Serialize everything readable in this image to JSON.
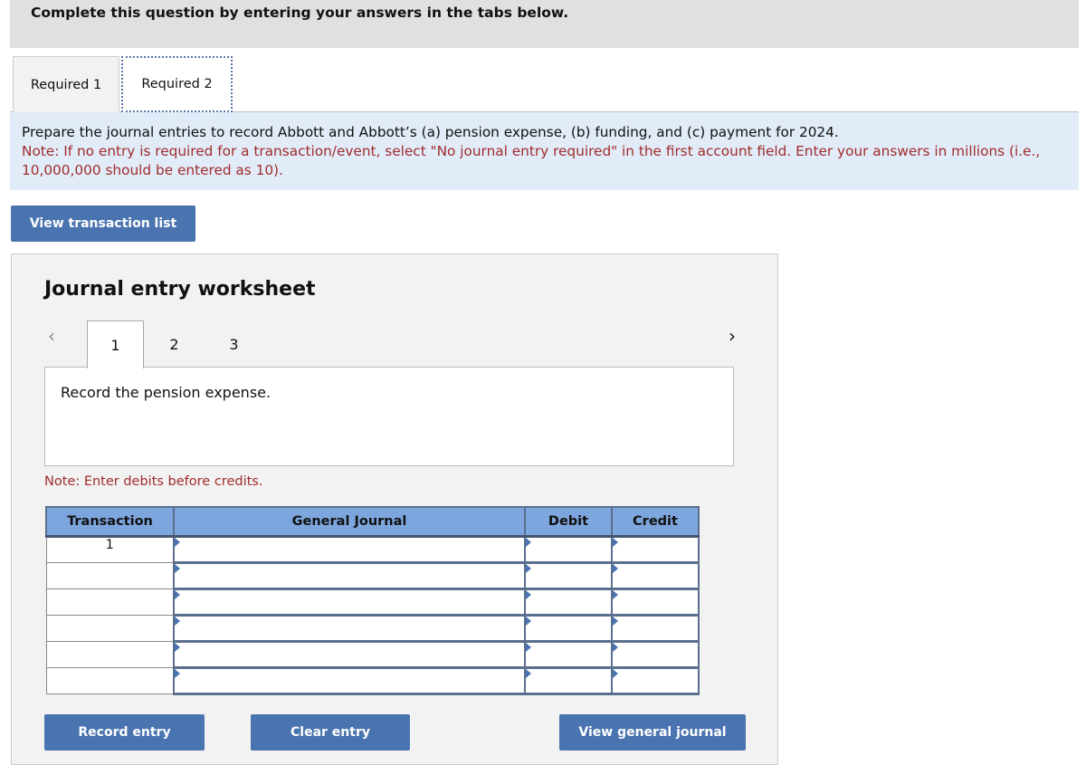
{
  "header": {
    "title": "Complete this question by entering your answers in the tabs below."
  },
  "tabs": [
    {
      "label": "Required 1",
      "active": false
    },
    {
      "label": "Required 2",
      "active": true
    }
  ],
  "instructions": {
    "main": "Prepare the journal entries to record Abbott and Abbott’s (a) pension expense, (b) funding, and (c) payment for 2024.",
    "note": "Note: If no entry is required for a transaction/event, select \"No journal entry required\" in the first account field. Enter your answers in millions (i.e., 10,000,000 should be entered as 10)."
  },
  "view_transaction_list_label": "View transaction list",
  "worksheet": {
    "title": "Journal entry worksheet",
    "nav": {
      "prev_icon": "‹",
      "next_icon": "›",
      "pages": [
        "1",
        "2",
        "3"
      ],
      "active_page": "1"
    },
    "description": "Record the pension expense.",
    "note": "Note: Enter debits before credits.",
    "table": {
      "headers": [
        "Transaction",
        "General Journal",
        "Debit",
        "Credit"
      ],
      "rows": [
        {
          "transaction": "1",
          "account": "",
          "debit": "",
          "credit": ""
        },
        {
          "transaction": "",
          "account": "",
          "debit": "",
          "credit": ""
        },
        {
          "transaction": "",
          "account": "",
          "debit": "",
          "credit": ""
        },
        {
          "transaction": "",
          "account": "",
          "debit": "",
          "credit": ""
        },
        {
          "transaction": "",
          "account": "",
          "debit": "",
          "credit": ""
        },
        {
          "transaction": "",
          "account": "",
          "debit": "",
          "credit": ""
        }
      ]
    },
    "buttons": {
      "record": "Record entry",
      "clear": "Clear entry",
      "view_journal": "View general journal"
    }
  }
}
